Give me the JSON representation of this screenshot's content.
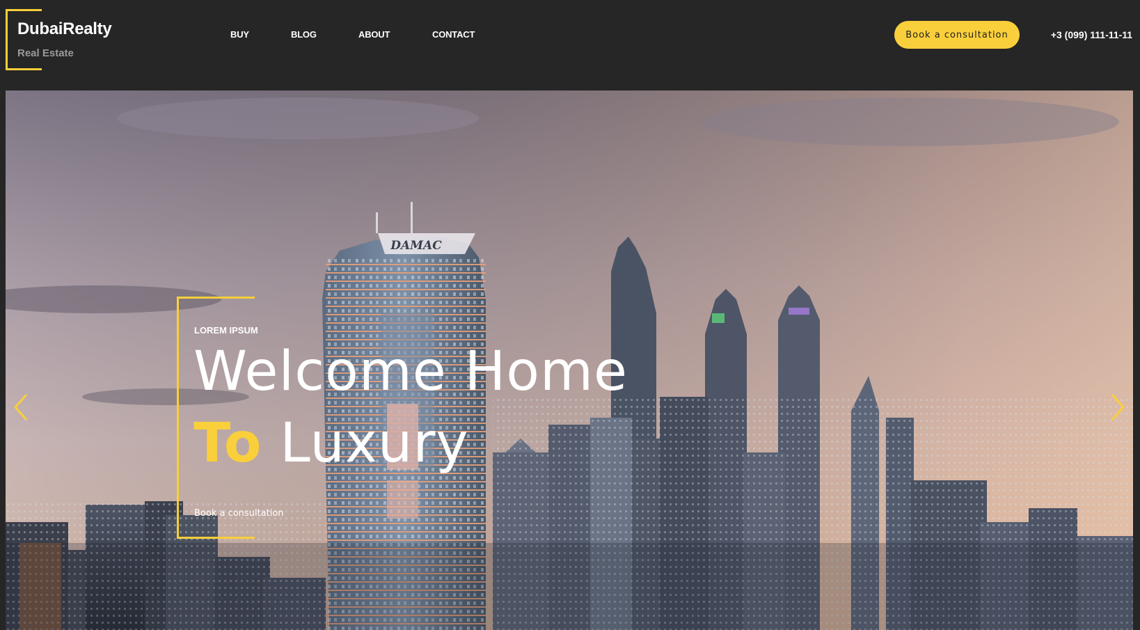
{
  "brand": {
    "name": "DubaiRealty",
    "tagline": "Real Estate"
  },
  "nav": {
    "items": [
      {
        "label": "BUY"
      },
      {
        "label": "BLOG"
      },
      {
        "label": "ABOUT"
      },
      {
        "label": "CONTACT"
      }
    ]
  },
  "header": {
    "cta_label": "Book a consultation",
    "phone": "+3 (099) 111-11-11"
  },
  "hero": {
    "eyebrow": "LOREM IPSUM",
    "headline_line1": "Welcome Home",
    "headline_accent": "To",
    "headline_line2_rest": "Luxury",
    "link_label": "Book a consultation",
    "building_sign": "DAMAC"
  },
  "colors": {
    "accent": "#f9cf3c",
    "background": "#262626",
    "text": "#ffffff"
  },
  "icons": {
    "prev": "chevron-left-icon",
    "next": "chevron-right-icon"
  }
}
